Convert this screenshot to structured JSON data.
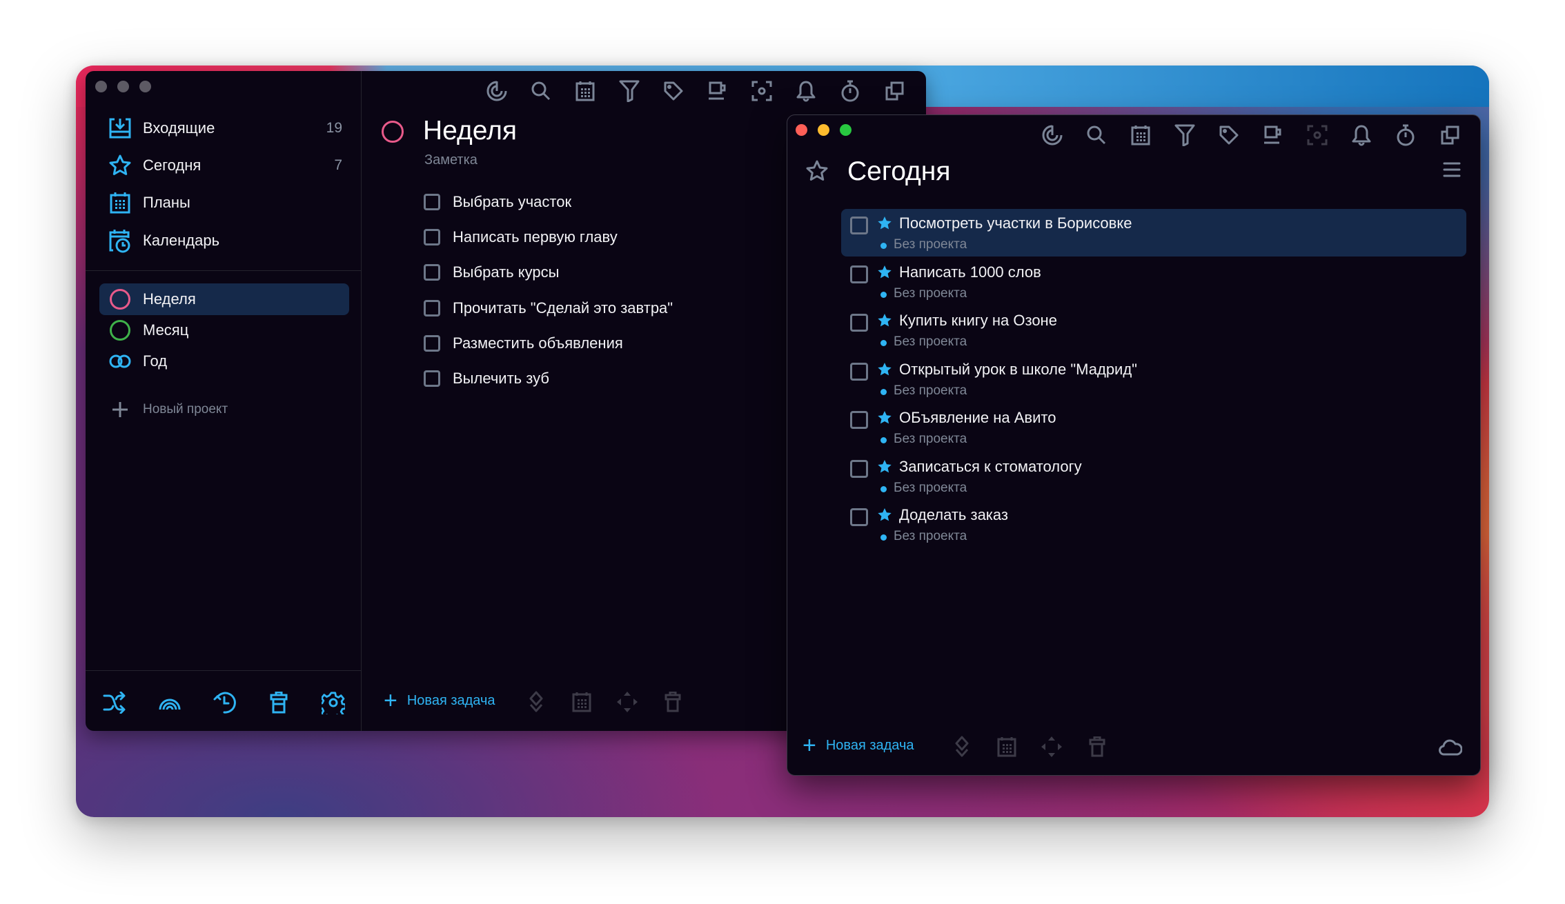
{
  "left_window": {
    "sidebar": {
      "smart_lists": [
        {
          "label": "Входящие",
          "count": "19",
          "icon": "inbox-icon"
        },
        {
          "label": "Сегодня",
          "count": "7",
          "icon": "star-icon"
        },
        {
          "label": "Планы",
          "count": "",
          "icon": "calendar-grid-icon"
        },
        {
          "label": "Календарь",
          "count": "",
          "icon": "calendar-clock-icon"
        }
      ],
      "projects": [
        {
          "label": "Неделя",
          "color": "#e85a8a",
          "icon": "circle-icon",
          "selected": true
        },
        {
          "label": "Месяц",
          "color": "#3fb24a",
          "icon": "circle-icon",
          "selected": false
        },
        {
          "label": "Год",
          "color": "#2fb4f3",
          "icon": "infinity-icon",
          "selected": false
        }
      ],
      "new_project_label": "Новый проект",
      "footer_icons": [
        "shuffle-icon",
        "rainbow-icon",
        "history-icon",
        "trash-icon",
        "gear-icon"
      ]
    },
    "toolbar_icons": [
      "focus-icon",
      "search-icon",
      "calendar-icon",
      "filter-icon",
      "tag-icon",
      "cup-icon",
      "scan-icon",
      "bell-icon",
      "stopwatch-icon",
      "windows-icon"
    ],
    "main": {
      "title": "Неделя",
      "subtitle": "Заметка",
      "tasks": [
        "Выбрать участок",
        "Написать первую главу",
        "Выбрать курсы",
        "Прочитать \"Сделай это завтра\"",
        "Разместить объявления",
        "Вылечить зуб"
      ],
      "new_task_label": "Новая задача",
      "footer_icons": [
        "priority-icon",
        "calendar-icon",
        "move-icon",
        "trash-icon"
      ]
    }
  },
  "right_window": {
    "toolbar_icons": [
      "focus-icon",
      "search-icon",
      "calendar-icon",
      "filter-icon",
      "tag-icon",
      "cup-icon",
      "scan-icon",
      "bell-icon",
      "stopwatch-icon",
      "windows-icon"
    ],
    "title": "Сегодня",
    "tasks": [
      {
        "title": "Посмотреть участки в Борисовке",
        "project": "Без проекта",
        "selected": true
      },
      {
        "title": "Написать 1000 слов",
        "project": "Без проекта",
        "selected": false
      },
      {
        "title": "Купить книгу на Озоне",
        "project": "Без проекта",
        "selected": false
      },
      {
        "title": "Открытый урок в школе \"Мадрид\"",
        "project": "Без проекта",
        "selected": false
      },
      {
        "title": "ОБъявление на Авито",
        "project": "Без проекта",
        "selected": false
      },
      {
        "title": "Записаться к стоматологу",
        "project": "Без проекта",
        "selected": false
      },
      {
        "title": "Доделать заказ",
        "project": "Без проекта",
        "selected": false
      }
    ],
    "new_task_label": "Новая задача",
    "footer_icons": [
      "priority-icon",
      "calendar-icon",
      "move-icon",
      "trash-icon"
    ],
    "sync_icon": "cloud-icon"
  },
  "colors": {
    "accent": "#2fb4f3",
    "window_bg": "#0a0514",
    "selection": "#15294a",
    "muted": "#7f8796"
  }
}
